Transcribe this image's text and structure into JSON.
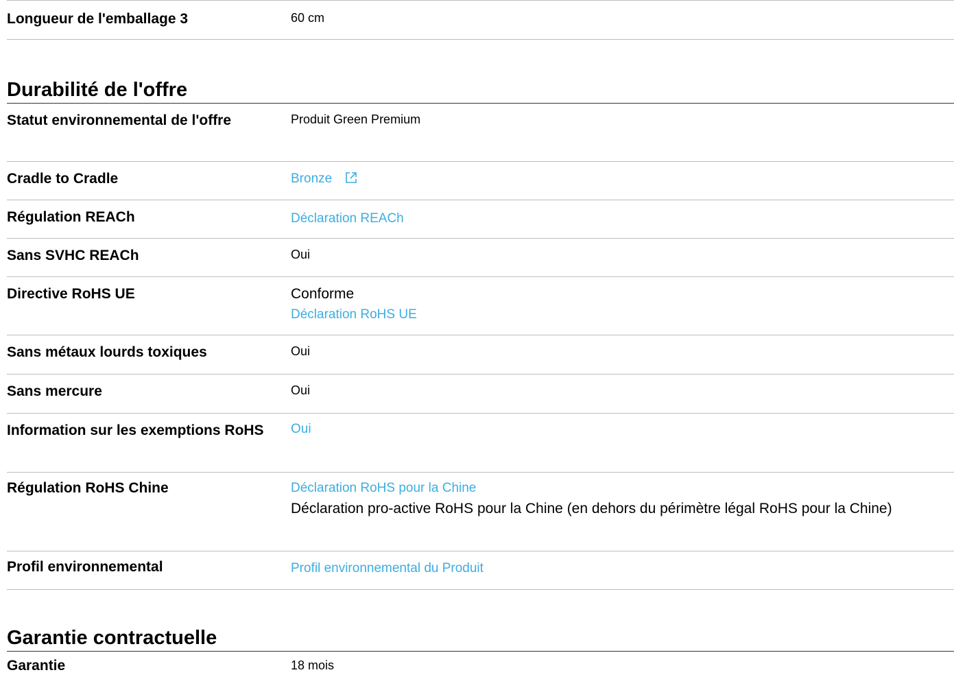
{
  "packaging": {
    "label": "Longueur de l'emballage 3",
    "value": "60 cm"
  },
  "durability": {
    "title": "Durabilité de l'offre",
    "rows": [
      {
        "label": "Statut environnemental de l'offre",
        "value": "Produit Green Premium"
      },
      {
        "label": "Cradle to Cradle",
        "link": "Bronze"
      },
      {
        "label": "Régulation REACh",
        "link": "Déclaration REACh"
      },
      {
        "label": "Sans SVHC REACh",
        "value": "Oui"
      },
      {
        "label": "Directive RoHS UE",
        "value": "Conforme",
        "link": "Déclaration RoHS UE"
      },
      {
        "label": "Sans métaux lourds toxiques",
        "value": "Oui"
      },
      {
        "label": "Sans mercure",
        "value": "Oui"
      },
      {
        "label": "Information sur les exemptions RoHS",
        "link": "Oui"
      },
      {
        "label": "Régulation RoHS Chine",
        "link": "Déclaration RoHS pour la Chine",
        "value": "Déclaration pro-active RoHS pour la Chine (en dehors du périmètre légal RoHS pour la Chine)"
      },
      {
        "label": "Profil environnemental",
        "link": "Profil environnemental du Produit"
      }
    ]
  },
  "warranty": {
    "title": "Garantie contractuelle",
    "rows": [
      {
        "label": "Garantie",
        "value": "18 mois"
      }
    ]
  },
  "icons": {
    "external_link": "external-link-icon"
  },
  "colors": {
    "link": "#3dade0",
    "divider": "#bdbdbd",
    "section_rule": "#333333"
  }
}
